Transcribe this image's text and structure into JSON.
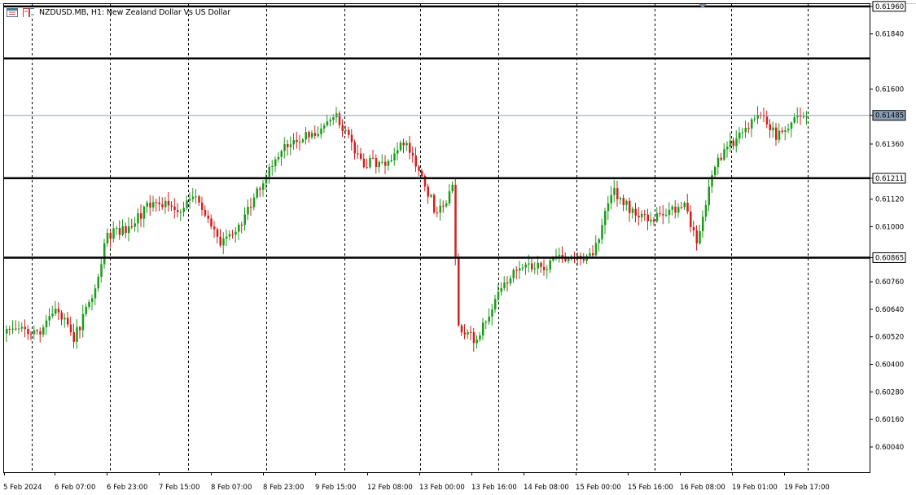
{
  "window": {
    "title": "NZDUSD.MB, H1:  New Zealand Dollar Vs US Dollar",
    "icons": [
      "chart-list-icon",
      "one-click-trading-icon"
    ]
  },
  "chart_data": {
    "type": "candlestick",
    "symbol": "NZDUSD.MB",
    "timeframe": "H1",
    "description": "New Zealand Dollar Vs US Dollar",
    "ylim": [
      0.5993,
      0.6197
    ],
    "y_ticks": [
      "0.61960",
      "0.61840",
      "0.61600",
      "0.61485",
      "0.61360",
      "0.61211",
      "0.61120",
      "0.61000",
      "0.60865",
      "0.60760",
      "0.60640",
      "0.60520",
      "0.60400",
      "0.60280",
      "0.60160",
      "0.60040"
    ],
    "x_ticks": [
      "5 Feb 2024",
      "6 Feb 07:00",
      "6 Feb 23:00",
      "7 Feb 15:00",
      "8 Feb 07:00",
      "8 Feb 23:00",
      "9 Feb 15:00",
      "12 Feb 08:00",
      "13 Feb 00:00",
      "13 Feb 16:00",
      "14 Feb 08:00",
      "15 Feb 00:00",
      "15 Feb 16:00",
      "16 Feb 08:00",
      "19 Feb 01:00",
      "19 Feb 17:00"
    ],
    "grid": "vertical dashed",
    "current_price": "0.61485",
    "horizontal_levels": [
      {
        "price": 0.6196,
        "label": "0.61960"
      },
      {
        "price": 0.61733,
        "label": "0.61733"
      },
      {
        "price": 0.61211,
        "label": "0.61211"
      },
      {
        "price": 0.60865,
        "label": "0.60865"
      }
    ],
    "bull_color": "#1a9b1a",
    "bear_color": "#d41e1e",
    "level_color": "#000000",
    "bid_line_color": "#8aa0b8",
    "close_anchors": [
      [
        0,
        0.6056
      ],
      [
        10,
        0.6053
      ],
      [
        16,
        0.6065
      ],
      [
        22,
        0.6051
      ],
      [
        28,
        0.6069
      ],
      [
        33,
        0.6096
      ],
      [
        40,
        0.61
      ],
      [
        48,
        0.6111
      ],
      [
        56,
        0.6108
      ],
      [
        63,
        0.6112
      ],
      [
        70,
        0.6094
      ],
      [
        77,
        0.6102
      ],
      [
        83,
        0.6118
      ],
      [
        92,
        0.6136
      ],
      [
        100,
        0.614
      ],
      [
        108,
        0.6148
      ],
      [
        116,
        0.6128
      ],
      [
        124,
        0.6128
      ],
      [
        130,
        0.6137
      ],
      [
        135,
        0.6126
      ],
      [
        140,
        0.6108
      ],
      [
        143,
        0.6108
      ],
      [
        146,
        0.6116
      ],
      [
        148,
        0.6056
      ],
      [
        154,
        0.605
      ],
      [
        160,
        0.6068
      ],
      [
        168,
        0.6083
      ],
      [
        176,
        0.6083
      ],
      [
        184,
        0.6087
      ],
      [
        192,
        0.6086
      ],
      [
        198,
        0.6116
      ],
      [
        206,
        0.6105
      ],
      [
        214,
        0.6104
      ],
      [
        222,
        0.611
      ],
      [
        226,
        0.6094
      ],
      [
        232,
        0.6128
      ],
      [
        240,
        0.614
      ],
      [
        246,
        0.6149
      ],
      [
        252,
        0.614
      ],
      [
        260,
        0.6148
      ]
    ]
  }
}
